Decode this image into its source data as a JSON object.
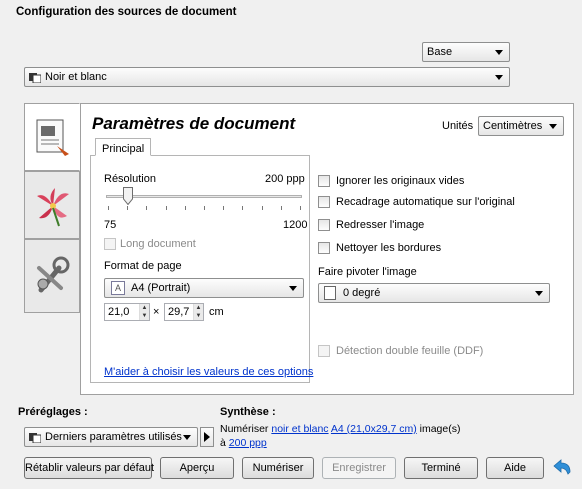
{
  "header": {
    "title": "Configuration des sources de document",
    "mode_select": "Base",
    "color_select": "Noir et blanc"
  },
  "panel": {
    "title": "Paramètres de document",
    "units_label": "Unités",
    "units_value": "Centimètres",
    "tab_principal": "Principal"
  },
  "left": {
    "resolution_label": "Résolution",
    "resolution_value": "200 ppp",
    "slider_min": "75",
    "slider_max": "1200",
    "slider_position": 0.112,
    "long_document": "Long document",
    "page_format_label": "Format de page",
    "page_format_value": "A4 (Portrait)",
    "width_value": "21,0",
    "times": "×",
    "height_value": "29,7",
    "unit": "cm",
    "help_link": "M'aider à choisir les valeurs de ces options"
  },
  "right": {
    "ignore_blank": "Ignorer les originaux vides",
    "auto_crop": "Recadrage automatique sur l'original",
    "straighten": "Redresser l'image",
    "clean_borders": "Nettoyer les bordures",
    "rotate_label": "Faire pivoter l'image",
    "rotate_value": "0 degré",
    "double_feed": "Détection double feuille (DDF)"
  },
  "presets": {
    "label": "Préréglages :",
    "value": "Derniers paramètres utilisés"
  },
  "summary": {
    "label": "Synthèse :",
    "prefix": "Numériser",
    "color_link": "noir et blanc",
    "size_link": "A4 (21,0x29,7 cm)",
    "suffix": "image(s)",
    "at": "à",
    "res_link": "200 ppp"
  },
  "buttons": {
    "reset": "Rétablir valeurs par défaut",
    "preview": "Aperçu",
    "scan": "Numériser",
    "save": "Enregistrer",
    "done": "Terminé",
    "help": "Aide"
  },
  "icons": [
    "document-settings-icon",
    "flower-image-icon",
    "tools-icon",
    "back-arrow-icon"
  ]
}
